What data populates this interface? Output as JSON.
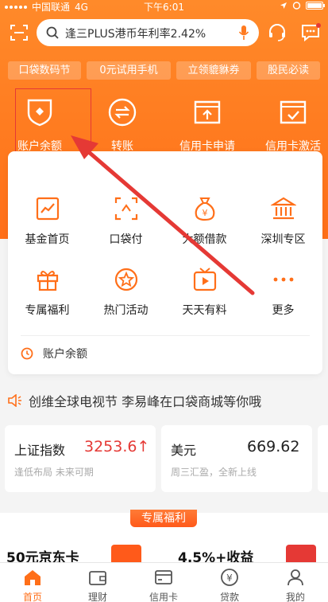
{
  "status_bar": {
    "carrier": "中国联通",
    "network": "4G",
    "time": "下午6:01"
  },
  "search": {
    "placeholder": "逢三PLUS港币年利率2.42%"
  },
  "tags": [
    "口袋数码节",
    "0元试用手机",
    "立领貔貅券",
    "股民必读"
  ],
  "quick_actions": [
    {
      "label": "账户余额",
      "icon": "wallet-shield-icon"
    },
    {
      "label": "转账",
      "icon": "transfer-icon"
    },
    {
      "label": "信用卡申请",
      "icon": "card-apply-icon"
    },
    {
      "label": "信用卡激活",
      "icon": "card-activate-icon"
    }
  ],
  "grid": [
    {
      "label": "基金首页",
      "icon": "fund-chart-icon"
    },
    {
      "label": "口袋付",
      "icon": "scan-pay-icon"
    },
    {
      "label": "大额借款",
      "icon": "money-bag-icon"
    },
    {
      "label": "深圳专区",
      "icon": "bank-building-icon"
    },
    {
      "label": "专属福利",
      "icon": "gift-icon"
    },
    {
      "label": "热门活动",
      "icon": "star-badge-icon"
    },
    {
      "label": "天天有料",
      "icon": "video-play-icon"
    },
    {
      "label": "更多",
      "icon": "more-dots-icon"
    }
  ],
  "recent": {
    "label": "账户余额",
    "icon": "clock-icon"
  },
  "notice": {
    "text": "创维全球电视节 李易峰在口袋商城等你哦",
    "icon": "speaker-icon"
  },
  "market": [
    {
      "name": "上证指数",
      "value": "3253.6↑",
      "sub": "逢低布局 未来可期",
      "value_color": "#e53935"
    },
    {
      "name": "美元",
      "value": "669.62",
      "sub": "周三汇盈，全新上线",
      "value_color": "#222222"
    }
  ],
  "welfare": {
    "title": "专属福利",
    "items": [
      {
        "label": "50元京东卡"
      },
      {
        "label": "4.5%+收益"
      }
    ]
  },
  "tabbar": [
    {
      "label": "首页",
      "icon": "home-icon",
      "active": true
    },
    {
      "label": "理财",
      "icon": "wallet-icon",
      "active": false
    },
    {
      "label": "信用卡",
      "icon": "credit-card-icon",
      "active": false
    },
    {
      "label": "贷款",
      "icon": "loan-coin-icon",
      "active": false
    },
    {
      "label": "我的",
      "icon": "user-icon",
      "active": false
    }
  ],
  "colors": {
    "brand": "#ff7a1f",
    "accent_red": "#e53935"
  }
}
